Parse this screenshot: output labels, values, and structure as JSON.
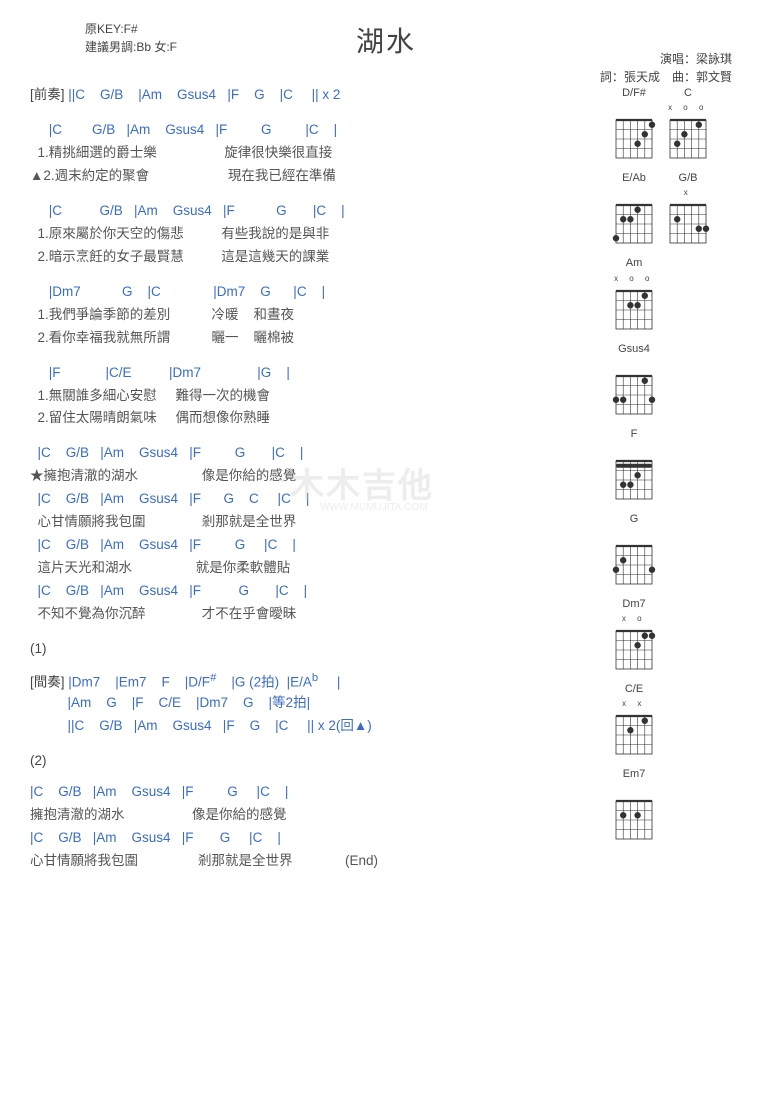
{
  "header": {
    "original_key": "原KEY:F#",
    "suggest_key": "建議男調:Bb 女:F",
    "title": "湖水",
    "singer_label": "演唱：",
    "singer": "梁詠琪",
    "lyricist_label": "詞：",
    "lyricist": "張天成",
    "composer_label": "曲：",
    "composer": "郭文賢"
  },
  "watermark": "木木吉他",
  "watermark_sub": "WWW.MUMUJITA.COM",
  "intro": {
    "label": "[前奏]",
    "chords": " ||C    G/B    |Am    Gsus4   |F    G    |C     || x 2"
  },
  "verses": [
    {
      "chord_line": "     |C        G/B   |Am    Gsus4   |F         G         |C    |",
      "l1": "  1.精挑細選的爵士樂                  旋律很快樂很直接",
      "l2": "▲2.週末約定的聚會                     現在我已經在準備"
    },
    {
      "chord_line": "     |C          G/B   |Am    Gsus4   |F           G       |C    |",
      "l1": "  1.原來屬於你天空的傷悲          有些我說的是與非",
      "l2": "  2.暗示烹飪的女子最賢慧          這是這幾天的課業"
    },
    {
      "chord_line": "     |Dm7           G    |C              |Dm7    G      |C    |",
      "l1": "  1.我們爭論季節的差別           冷暖    和晝夜",
      "l2": "  2.看你幸福我就無所謂           曬一    曬棉被"
    },
    {
      "chord_line": "     |F            |C/E          |Dm7               |G    |",
      "l1": "  1.無關誰多細心安慰     難得一次的機會",
      "l2": "  2.留住太陽晴朗氣味     偶而想像你熟睡"
    }
  ],
  "chorus": [
    {
      "chord": "  |C    G/B   |Am    Gsus4   |F         G       |C    |",
      "lyric": "★擁抱清澈的湖水                 像是你給的感覺"
    },
    {
      "chord": "  |C    G/B   |Am    Gsus4   |F      G    C     |C    |",
      "lyric": "  心甘情願將我包圍               剎那就是全世界"
    },
    {
      "chord": "  |C    G/B   |Am    Gsus4   |F         G     |C    |",
      "lyric": "  這片天光和湖水                 就是你柔軟體貼"
    },
    {
      "chord": "  |C    G/B   |Am    Gsus4   |F          G       |C    |",
      "lyric": "  不知不覺為你沉醉               才不在乎會曖昧"
    }
  ],
  "section1": {
    "num": "(1)",
    "label": "[間奏]",
    "line1_a": " |Dm7    |Em7    F    |D/F",
    "line1_sharp": "#",
    "line1_b": "    |G (2拍)  |E/A",
    "line1_flat": "b",
    "line1_c": "     |",
    "line2": "          |Am    G    |F    C/E    |Dm7    G    |等2拍|",
    "line3": "          ||C    G/B   |Am    Gsus4   |F    G    |C     || x 2(回▲)"
  },
  "section2": {
    "num": "(2)",
    "rows": [
      {
        "chord": "|C    G/B   |Am    Gsus4   |F         G     |C    |",
        "lyric": "擁抱清澈的湖水                  像是你給的感覺"
      },
      {
        "chord": "|C    G/B   |Am    Gsus4   |F       G     |C    |",
        "lyric": "心甘情願將我包圍                剎那就是全世界              (End)"
      }
    ]
  },
  "diagrams": [
    {
      "row": 0,
      "name": "D/F#",
      "mutes": "      ",
      "dots": [
        [
          1,
          1
        ],
        [
          2,
          2
        ],
        [
          3,
          3
        ]
      ],
      "open": [
        4,
        5
      ]
    },
    {
      "row": 0,
      "name": "C",
      "mutes": "x   o o",
      "dots": [
        [
          1,
          2
        ],
        [
          2,
          4
        ],
        [
          3,
          5
        ]
      ]
    },
    {
      "row": 1,
      "name": "E/Ab",
      "mutes": "      ",
      "dots": [
        [
          1,
          3
        ],
        [
          2,
          4
        ],
        [
          2,
          5
        ],
        [
          4,
          6
        ]
      ]
    },
    {
      "row": 1,
      "name": "G/B",
      "mutes": "x     ",
      "dots": [
        [
          2,
          5
        ],
        [
          3,
          1
        ],
        [
          3,
          2
        ]
      ]
    },
    {
      "row": 2,
      "name": "Am",
      "mutes": "x o   o",
      "dots": [
        [
          1,
          2
        ],
        [
          2,
          3
        ],
        [
          2,
          4
        ]
      ]
    },
    {
      "row": 3,
      "name": "Gsus4",
      "mutes": "      ",
      "dots": [
        [
          1,
          2
        ],
        [
          3,
          1
        ],
        [
          3,
          5
        ],
        [
          3,
          6
        ]
      ]
    },
    {
      "row": 4,
      "name": "F",
      "mutes": "      ",
      "barre": 1,
      "dots": [
        [
          2,
          3
        ],
        [
          3,
          4
        ],
        [
          3,
          5
        ]
      ]
    },
    {
      "row": 5,
      "name": "G",
      "mutes": "      ",
      "dots": [
        [
          2,
          5
        ],
        [
          3,
          1
        ],
        [
          3,
          6
        ]
      ]
    },
    {
      "row": 6,
      "name": "Dm7",
      "mutes": "x o    ",
      "dots": [
        [
          1,
          1
        ],
        [
          1,
          2
        ],
        [
          2,
          3
        ]
      ]
    },
    {
      "row": 7,
      "name": "C/E",
      "mutes": "x x    ",
      "dots": [
        [
          1,
          2
        ],
        [
          2,
          4
        ]
      ]
    },
    {
      "row": 8,
      "name": "Em7",
      "mutes": "      ",
      "dots": [
        [
          2,
          5
        ],
        [
          2,
          3
        ]
      ]
    }
  ]
}
